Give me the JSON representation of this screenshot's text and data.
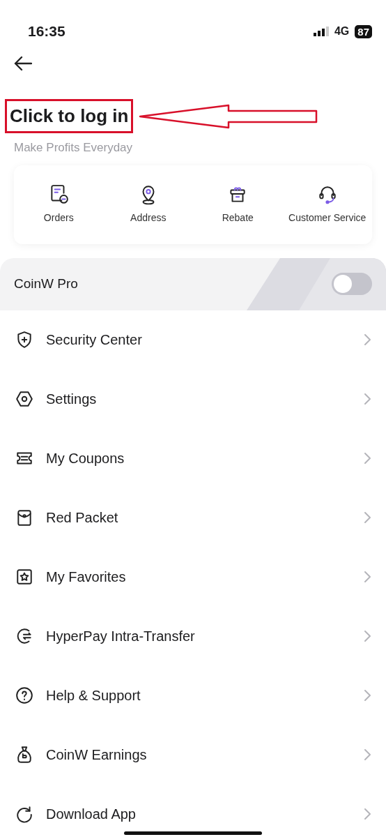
{
  "status_bar": {
    "time": "16:35",
    "network": "4G",
    "battery": "87"
  },
  "header": {
    "title": "Click to log in",
    "subtitle": "Make Profits Everyday"
  },
  "shortcuts": [
    {
      "label": "Orders"
    },
    {
      "label": "Address"
    },
    {
      "label": "Rebate"
    },
    {
      "label": "Customer Service"
    }
  ],
  "pro_mode": {
    "label": "CoinW Pro",
    "on": false
  },
  "menu": [
    {
      "label": "Security Center"
    },
    {
      "label": "Settings"
    },
    {
      "label": "My Coupons"
    },
    {
      "label": "Red Packet"
    },
    {
      "label": "My Favorites"
    },
    {
      "label": "HyperPay Intra-Transfer"
    },
    {
      "label": "Help & Support"
    },
    {
      "label": "CoinW Earnings"
    },
    {
      "label": "Download App"
    }
  ]
}
